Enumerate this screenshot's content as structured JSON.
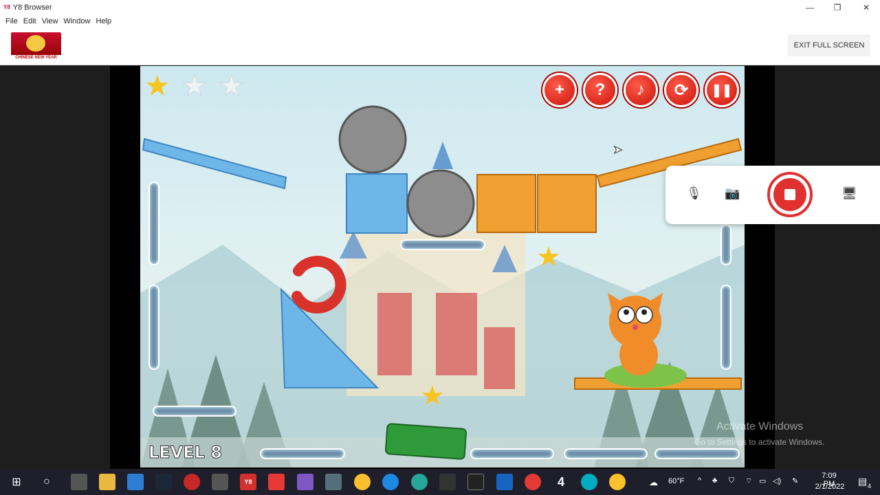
{
  "window": {
    "app_logo": "Y8",
    "title": "Y8 Browser",
    "minimize": "—",
    "maximize": "❐",
    "close": "✕"
  },
  "menu": {
    "items": [
      "File",
      "Edit",
      "View",
      "Window",
      "Help"
    ]
  },
  "toolbar": {
    "banner_text": "CHINESE NEW YEAR",
    "exit_fullscreen_label": "EXIT FULL SCREEN"
  },
  "game": {
    "level_label": "LEVEL 8",
    "stars_collected": 1,
    "stars_total": 3,
    "hud_buttons": [
      {
        "name": "add",
        "glyph": "+"
      },
      {
        "name": "help",
        "glyph": "?"
      },
      {
        "name": "music",
        "glyph": "♪"
      },
      {
        "name": "restart",
        "glyph": "⟳"
      },
      {
        "name": "pause",
        "glyph": "❚❚"
      }
    ]
  },
  "recorder": {
    "mic_icon": "🎙",
    "camera_icon": "📷",
    "screen_icon": "🖥"
  },
  "watermark": {
    "line1": "Activate Windows",
    "line2": "Go to Settings to activate Windows."
  },
  "taskbar": {
    "weather_temp": "60°F",
    "time": "7:09 PM",
    "date": "2/1/2022",
    "notification_count": "4"
  }
}
